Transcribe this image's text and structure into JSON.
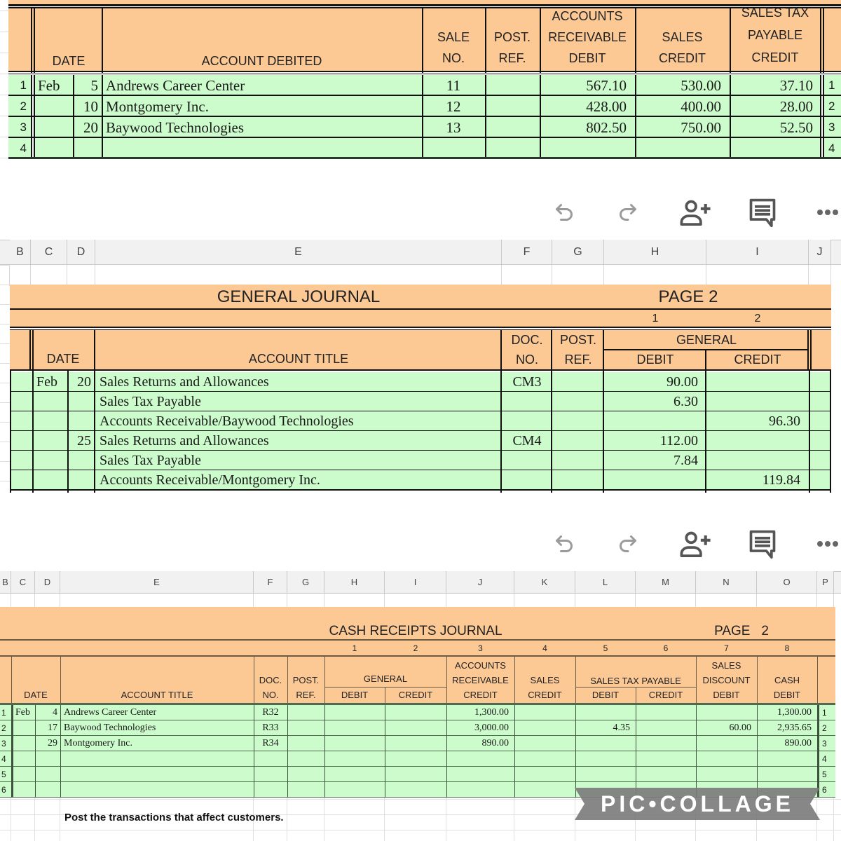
{
  "sales_journal": {
    "headers": {
      "date": "DATE",
      "account_debited": "ACCOUNT DEBITED",
      "sale_no": [
        "SALE",
        "NO."
      ],
      "post_ref": [
        "POST.",
        "REF."
      ],
      "ar_debit": [
        "ACCOUNTS",
        "RECEIVABLE",
        "DEBIT"
      ],
      "sales_credit": [
        "SALES",
        "CREDIT"
      ],
      "stp_credit": [
        "SALES TAX",
        "PAYABLE",
        "CREDIT"
      ]
    },
    "rows": [
      {
        "line": "1",
        "month": "Feb",
        "day": "5",
        "account": "Andrews Career Center",
        "sale_no": "11",
        "post_ref": "",
        "ar_debit": "567.10",
        "sales_credit": "530.00",
        "stp_credit": "37.10"
      },
      {
        "line": "2",
        "month": "",
        "day": "10",
        "account": "Montgomery Inc.",
        "sale_no": "12",
        "post_ref": "",
        "ar_debit": "428.00",
        "sales_credit": "400.00",
        "stp_credit": "28.00"
      },
      {
        "line": "3",
        "month": "",
        "day": "20",
        "account": "Baywood Technologies",
        "sale_no": "13",
        "post_ref": "",
        "ar_debit": "802.50",
        "sales_credit": "750.00",
        "stp_credit": "52.50"
      },
      {
        "line": "4",
        "month": "",
        "day": "",
        "account": "",
        "sale_no": "",
        "post_ref": "",
        "ar_debit": "",
        "sales_credit": "",
        "stp_credit": ""
      }
    ]
  },
  "toolbar": {
    "undo": "undo-icon",
    "redo": "redo-icon",
    "share": "add-person-icon",
    "comment": "comment-icon",
    "more": "more-icon"
  },
  "general_journal": {
    "columns": [
      "B",
      "C",
      "D",
      "E",
      "F",
      "G",
      "H",
      "I",
      "J"
    ],
    "title": "GENERAL JOURNAL",
    "page": "PAGE  2",
    "col_numbers": [
      "1",
      "2"
    ],
    "headers": {
      "date": "DATE",
      "account_title": "ACCOUNT TITLE",
      "doc_no": [
        "DOC.",
        "NO."
      ],
      "post_ref": [
        "POST.",
        "REF."
      ],
      "general": "GENERAL",
      "debit": "DEBIT",
      "credit": "CREDIT"
    },
    "rows": [
      {
        "month": "Feb",
        "day": "20",
        "account": "Sales Returns and Allowances",
        "doc": "CM3",
        "post_ref": "",
        "debit": "90.00",
        "credit": ""
      },
      {
        "month": "",
        "day": "",
        "account": "Sales Tax Payable",
        "doc": "",
        "post_ref": "",
        "debit": "6.30",
        "credit": ""
      },
      {
        "month": "",
        "day": "",
        "account": "Accounts Receivable/Baywood Technologies",
        "doc": "",
        "post_ref": "",
        "debit": "",
        "credit": "96.30"
      },
      {
        "month": "",
        "day": "25",
        "account": "Sales Returns and Allowances",
        "doc": "CM4",
        "post_ref": "",
        "debit": "112.00",
        "credit": ""
      },
      {
        "month": "",
        "day": "",
        "account": "Sales Tax Payable",
        "doc": "",
        "post_ref": "",
        "debit": "7.84",
        "credit": ""
      },
      {
        "month": "",
        "day": "",
        "account": "Accounts Receivable/Montgomery Inc.",
        "doc": "",
        "post_ref": "",
        "debit": "",
        "credit": "119.84"
      }
    ]
  },
  "cash_receipts_journal": {
    "columns": [
      "B",
      "C",
      "D",
      "E",
      "F",
      "G",
      "H",
      "I",
      "J",
      "K",
      "L",
      "M",
      "N",
      "O",
      "P"
    ],
    "title": "CASH RECEIPTS JOURNAL",
    "page": "PAGE   2",
    "col_numbers": [
      "1",
      "2",
      "3",
      "4",
      "5",
      "6",
      "7",
      "8"
    ],
    "headers": {
      "date": "DATE",
      "account_title": "ACCOUNT TITLE",
      "doc_no": [
        "DOC.",
        "NO."
      ],
      "post_ref": [
        "POST.",
        "REF."
      ],
      "general": "GENERAL",
      "gen_debit": "DEBIT",
      "gen_credit": "CREDIT",
      "ar_credit": [
        "ACCOUNTS",
        "RECEIVABLE",
        "CREDIT"
      ],
      "sales_credit": [
        "SALES",
        "CREDIT"
      ],
      "stp": "SALES TAX PAYABLE",
      "stp_debit": "DEBIT",
      "stp_credit": "CREDIT",
      "sd_debit": [
        "SALES",
        "DISCOUNT",
        "DEBIT"
      ],
      "cash_debit": [
        "CASH",
        "DEBIT"
      ]
    },
    "rows": [
      {
        "line": "1",
        "month": "Feb",
        "day": "4",
        "account": "Andrews Career Center",
        "doc": "R32",
        "post_ref": "",
        "gen_debit": "",
        "gen_credit": "",
        "ar_credit": "1,300.00",
        "sales_credit": "",
        "stp_debit": "",
        "stp_credit": "",
        "sd_debit": "",
        "cash_debit": "1,300.00"
      },
      {
        "line": "2",
        "month": "",
        "day": "17",
        "account": "Baywood Technologies",
        "doc": "R33",
        "post_ref": "",
        "gen_debit": "",
        "gen_credit": "",
        "ar_credit": "3,000.00",
        "sales_credit": "",
        "stp_debit": "4.35",
        "stp_credit": "",
        "sd_debit": "60.00",
        "cash_debit": "2,935.65"
      },
      {
        "line": "3",
        "month": "",
        "day": "29",
        "account": "Montgomery Inc.",
        "doc": "R34",
        "post_ref": "",
        "gen_debit": "",
        "gen_credit": "",
        "ar_credit": "890.00",
        "sales_credit": "",
        "stp_debit": "",
        "stp_credit": "",
        "sd_debit": "",
        "cash_debit": "890.00"
      },
      {
        "line": "4",
        "month": "",
        "day": "",
        "account": "",
        "doc": "",
        "post_ref": "",
        "gen_debit": "",
        "gen_credit": "",
        "ar_credit": "",
        "sales_credit": "",
        "stp_debit": "",
        "stp_credit": "",
        "sd_debit": "",
        "cash_debit": ""
      },
      {
        "line": "5",
        "month": "",
        "day": "",
        "account": "",
        "doc": "",
        "post_ref": "",
        "gen_debit": "",
        "gen_credit": "",
        "ar_credit": "",
        "sales_credit": "",
        "stp_debit": "",
        "stp_credit": "",
        "sd_debit": "",
        "cash_debit": ""
      },
      {
        "line": "6",
        "month": "",
        "day": "",
        "account": "",
        "doc": "",
        "post_ref": "",
        "gen_debit": "",
        "gen_credit": "",
        "ar_credit": "",
        "sales_credit": "",
        "stp_debit": "",
        "stp_credit": "",
        "sd_debit": "",
        "cash_debit": ""
      }
    ],
    "instruction": "Post the transactions that affect customers."
  },
  "watermark": "PIC•COLLAGE"
}
